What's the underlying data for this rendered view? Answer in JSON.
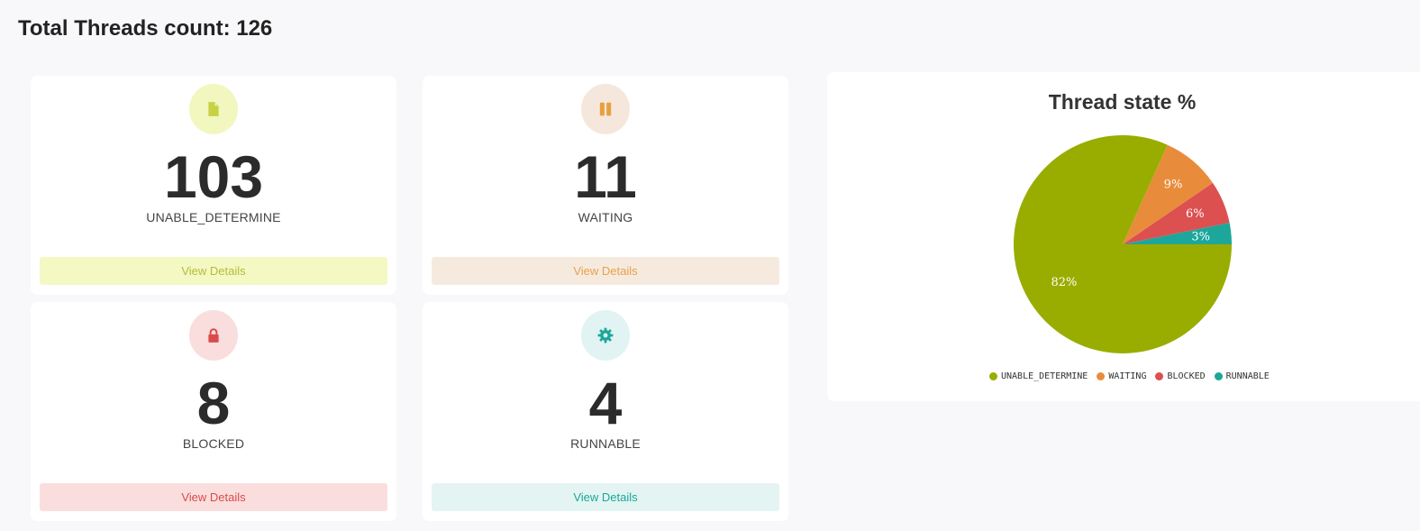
{
  "header": {
    "title": "Total Threads count: 126"
  },
  "cards": [
    {
      "count": "103",
      "label": "UNABLE_DETERMINE",
      "button": "View Details",
      "icon": "file-icon",
      "accent": "#c8d044",
      "bg": "#f4f8c3",
      "btn_text": "#b3bd3a",
      "circle": "#f2f7c0"
    },
    {
      "count": "11",
      "label": "WAITING",
      "button": "View Details",
      "icon": "pause-icon",
      "accent": "#e8a040",
      "bg": "#f6eadf",
      "btn_text": "#e7a24a",
      "circle": "#f5e7dc"
    },
    {
      "count": "8",
      "label": "BLOCKED",
      "button": "View Details",
      "icon": "lock-icon",
      "accent": "#d94b4b",
      "bg": "#fadede",
      "btn_text": "#d84c4c",
      "circle": "#fadddd"
    },
    {
      "count": "4",
      "label": "RUNNABLE",
      "button": "View Details",
      "icon": "gear-icon",
      "accent": "#1aa89a",
      "bg": "#e3f4f3",
      "btn_text": "#1aa89a",
      "circle": "#e1f3f2"
    }
  ],
  "chart_data": {
    "type": "pie",
    "title": "Thread state %",
    "categories": [
      "UNABLE_DETERMINE",
      "WAITING",
      "BLOCKED",
      "RUNNABLE"
    ],
    "values": [
      103,
      11,
      8,
      4
    ],
    "labels": [
      "82%",
      "9%",
      "6%",
      "3%"
    ],
    "colors": [
      "#99ad00",
      "#e88c3c",
      "#dc5050",
      "#1da79b"
    ],
    "legend": "bottom"
  }
}
